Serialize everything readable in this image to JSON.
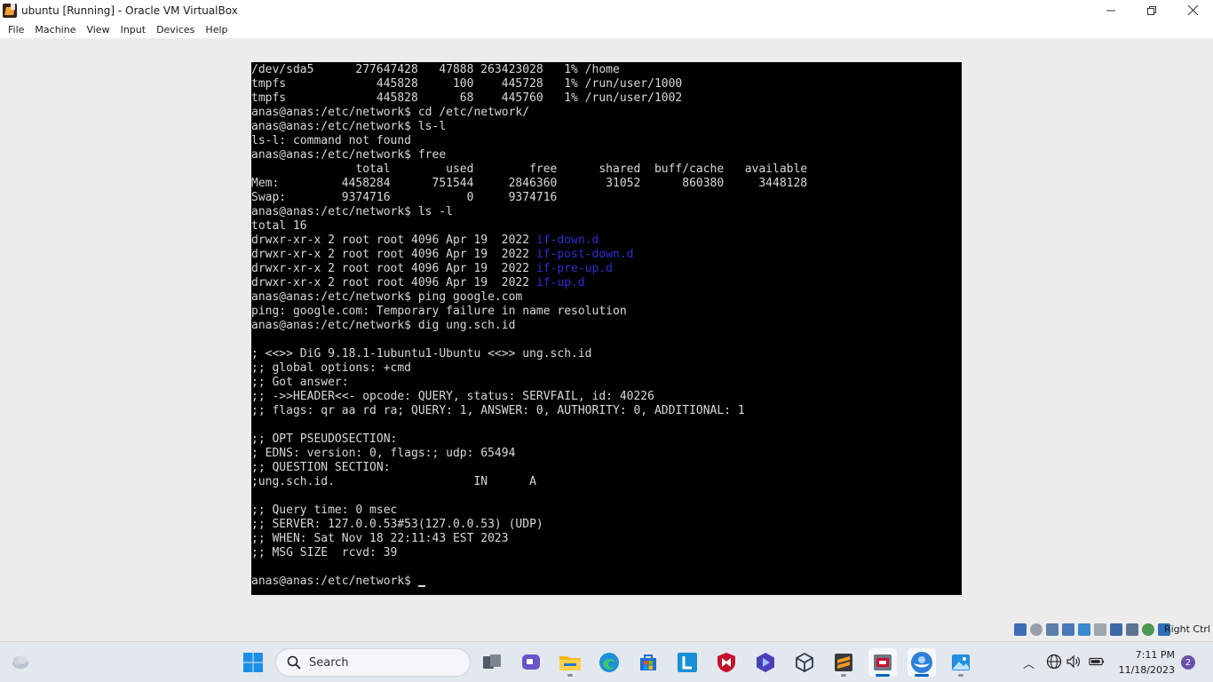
{
  "window": {
    "title": "ubuntu [Running] - Oracle VM VirtualBox",
    "controls": {
      "minimize": "—",
      "restore": "❐",
      "close": "✕"
    }
  },
  "menu": [
    "File",
    "Machine",
    "View",
    "Input",
    "Devices",
    "Help"
  ],
  "terminal": {
    "lines": [
      "/dev/sda5      277647428   47888 263423028   1% /home",
      "tmpfs             445828     100    445728   1% /run/user/1000",
      "tmpfs             445828      68    445760   1% /run/user/1002",
      "anas@anas:/etc/network$ cd /etc/network/",
      "anas@anas:/etc/network$ ls-l",
      "ls-l: command not found",
      "anas@anas:/etc/network$ free",
      "               total        used        free      shared  buff/cache   available",
      "Mem:         4458284      751544     2846360       31052      860380     3448128",
      "Swap:        9374716           0     9374716",
      "anas@anas:/etc/network$ ls -l",
      "total 16",
      "drwxr-xr-x 2 root root 4096 Apr 19  2022 ",
      "drwxr-xr-x 2 root root 4096 Apr 19  2022 ",
      "drwxr-xr-x 2 root root 4096 Apr 19  2022 ",
      "drwxr-xr-x 2 root root 4096 Apr 19  2022 ",
      "anas@anas:/etc/network$ ping google.com",
      "ping: google.com: Temporary failure in name resolution",
      "anas@anas:/etc/network$ dig ung.sch.id",
      "",
      "; <<>> DiG 9.18.1-1ubuntu1-Ubuntu <<>> ung.sch.id",
      ";; global options: +cmd",
      ";; Got answer:",
      ";; ->>HEADER<<- opcode: QUERY, status: SERVFAIL, id: 40226",
      ";; flags: qr aa rd ra; QUERY: 1, ANSWER: 0, AUTHORITY: 0, ADDITIONAL: 1",
      "",
      ";; OPT PSEUDOSECTION:",
      "; EDNS: version: 0, flags:; udp: 65494",
      ";; QUESTION SECTION:",
      ";ung.sch.id.                    IN      A",
      "",
      ";; Query time: 0 msec",
      ";; SERVER: 127.0.0.53#53(127.0.0.53) (UDP)",
      ";; WHEN: Sat Nov 18 22:11:43 EST 2023",
      ";; MSG SIZE  rcvd: 39",
      "",
      "anas@anas:/etc/network$ "
    ],
    "dir_names": [
      "if-down.d",
      "if-post-down.d",
      "if-pre-up.d",
      "if-up.d"
    ],
    "dir_color": "#2c2cd6"
  },
  "status_bar": {
    "host_key": "Right Ctrl"
  },
  "taskbar": {
    "search_label": "Search",
    "clock_time": "7:11 PM",
    "clock_date": "11/18/2023",
    "notification_count": "2",
    "accent": "#0067c0"
  }
}
